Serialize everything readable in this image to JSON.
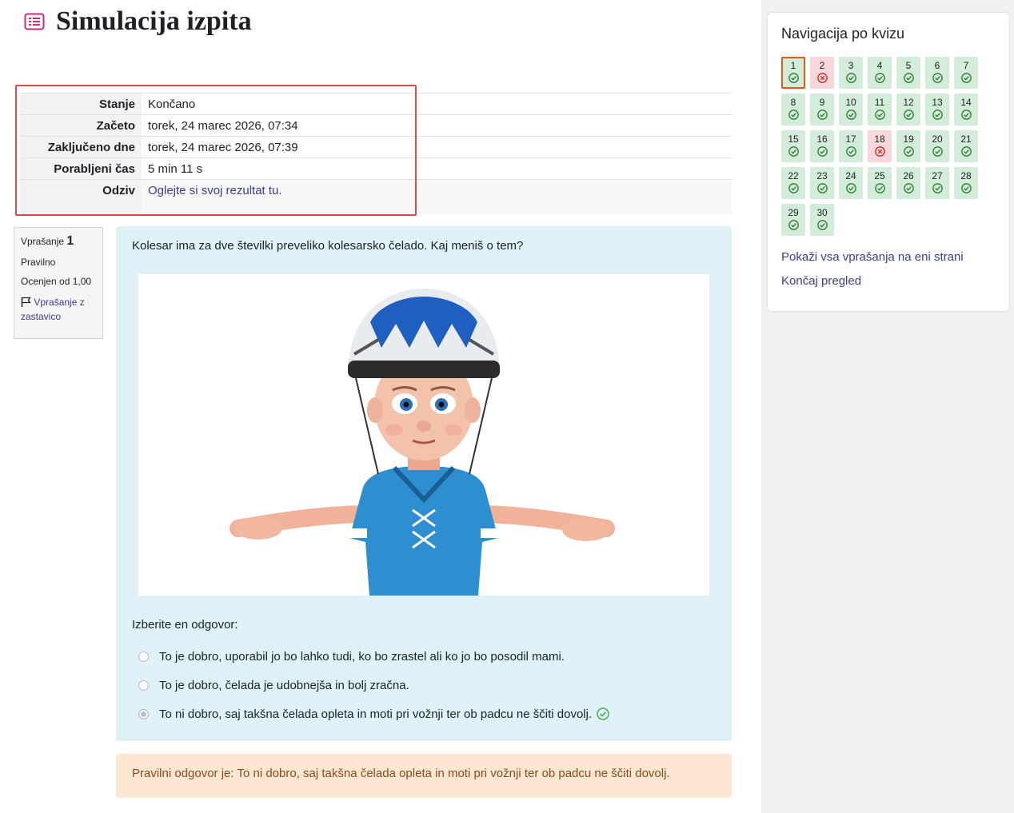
{
  "page": {
    "title": "Simulacija izpita"
  },
  "summary": [
    {
      "label": "Stanje",
      "value": "Končano"
    },
    {
      "label": "Začeto",
      "value": "torek, 24 marec 2026, 07:34"
    },
    {
      "label": "Zaključeno dne",
      "value": "torek, 24 marec 2026, 07:39"
    },
    {
      "label": "Porabljeni čas",
      "value": "5 min 11 s"
    },
    {
      "label": "Odziv",
      "value": "Oglejte si svoj rezultat tu."
    }
  ],
  "question_info": {
    "prefix": "Vprašanje",
    "number": "1",
    "state": "Pravilno",
    "grade": "Ocenjen od 1,00",
    "flag_label": "Vprašanje z zastavico"
  },
  "question": {
    "text": "Kolesar ima za dve številki preveliko kolesarsko čelado. Kaj meniš o tem?",
    "prompt": "Izberite en odgovor:",
    "answers": [
      {
        "text": "To je dobro, uporabil jo bo lahko tudi, ko bo zrastel ali ko jo bo posodil mami.",
        "selected": false
      },
      {
        "text": "To je dobro, čelada je udobnejša in bolj zračna.",
        "selected": false
      },
      {
        "text": "To ni dobro, saj takšna čelada opleta in moti pri vožnji ter ob padcu ne ščiti dovolj.",
        "selected": true,
        "correct": true
      }
    ]
  },
  "feedback": {
    "text": "Pravilni odgovor je: To ni dobro, saj takšna čelada opleta in moti pri vožnji ter ob padcu ne ščiti dovolj."
  },
  "nav": {
    "title": "Navigacija po kvizu",
    "questions": [
      {
        "n": "1",
        "status": "correct",
        "current": true
      },
      {
        "n": "2",
        "status": "wrong"
      },
      {
        "n": "3",
        "status": "correct"
      },
      {
        "n": "4",
        "status": "correct"
      },
      {
        "n": "5",
        "status": "correct"
      },
      {
        "n": "6",
        "status": "correct"
      },
      {
        "n": "7",
        "status": "correct"
      },
      {
        "n": "8",
        "status": "correct"
      },
      {
        "n": "9",
        "status": "correct"
      },
      {
        "n": "10",
        "status": "correct"
      },
      {
        "n": "11",
        "status": "correct"
      },
      {
        "n": "12",
        "status": "correct"
      },
      {
        "n": "13",
        "status": "correct"
      },
      {
        "n": "14",
        "status": "correct"
      },
      {
        "n": "15",
        "status": "correct"
      },
      {
        "n": "16",
        "status": "correct"
      },
      {
        "n": "17",
        "status": "correct"
      },
      {
        "n": "18",
        "status": "wrong"
      },
      {
        "n": "19",
        "status": "correct"
      },
      {
        "n": "20",
        "status": "correct"
      },
      {
        "n": "21",
        "status": "correct"
      },
      {
        "n": "22",
        "status": "correct"
      },
      {
        "n": "23",
        "status": "correct"
      },
      {
        "n": "24",
        "status": "correct"
      },
      {
        "n": "25",
        "status": "correct"
      },
      {
        "n": "26",
        "status": "correct"
      },
      {
        "n": "27",
        "status": "correct"
      },
      {
        "n": "28",
        "status": "correct"
      },
      {
        "n": "29",
        "status": "correct"
      },
      {
        "n": "30",
        "status": "correct"
      }
    ],
    "show_all_label": "Pokaži vsa vprašanja na eni strani",
    "finish_label": "Končaj pregled"
  },
  "colors": {
    "correct_bg": "#d4edda",
    "wrong_bg": "#f8d7da",
    "accent": "#3c3d8f",
    "highlight": "#d94a4a"
  }
}
